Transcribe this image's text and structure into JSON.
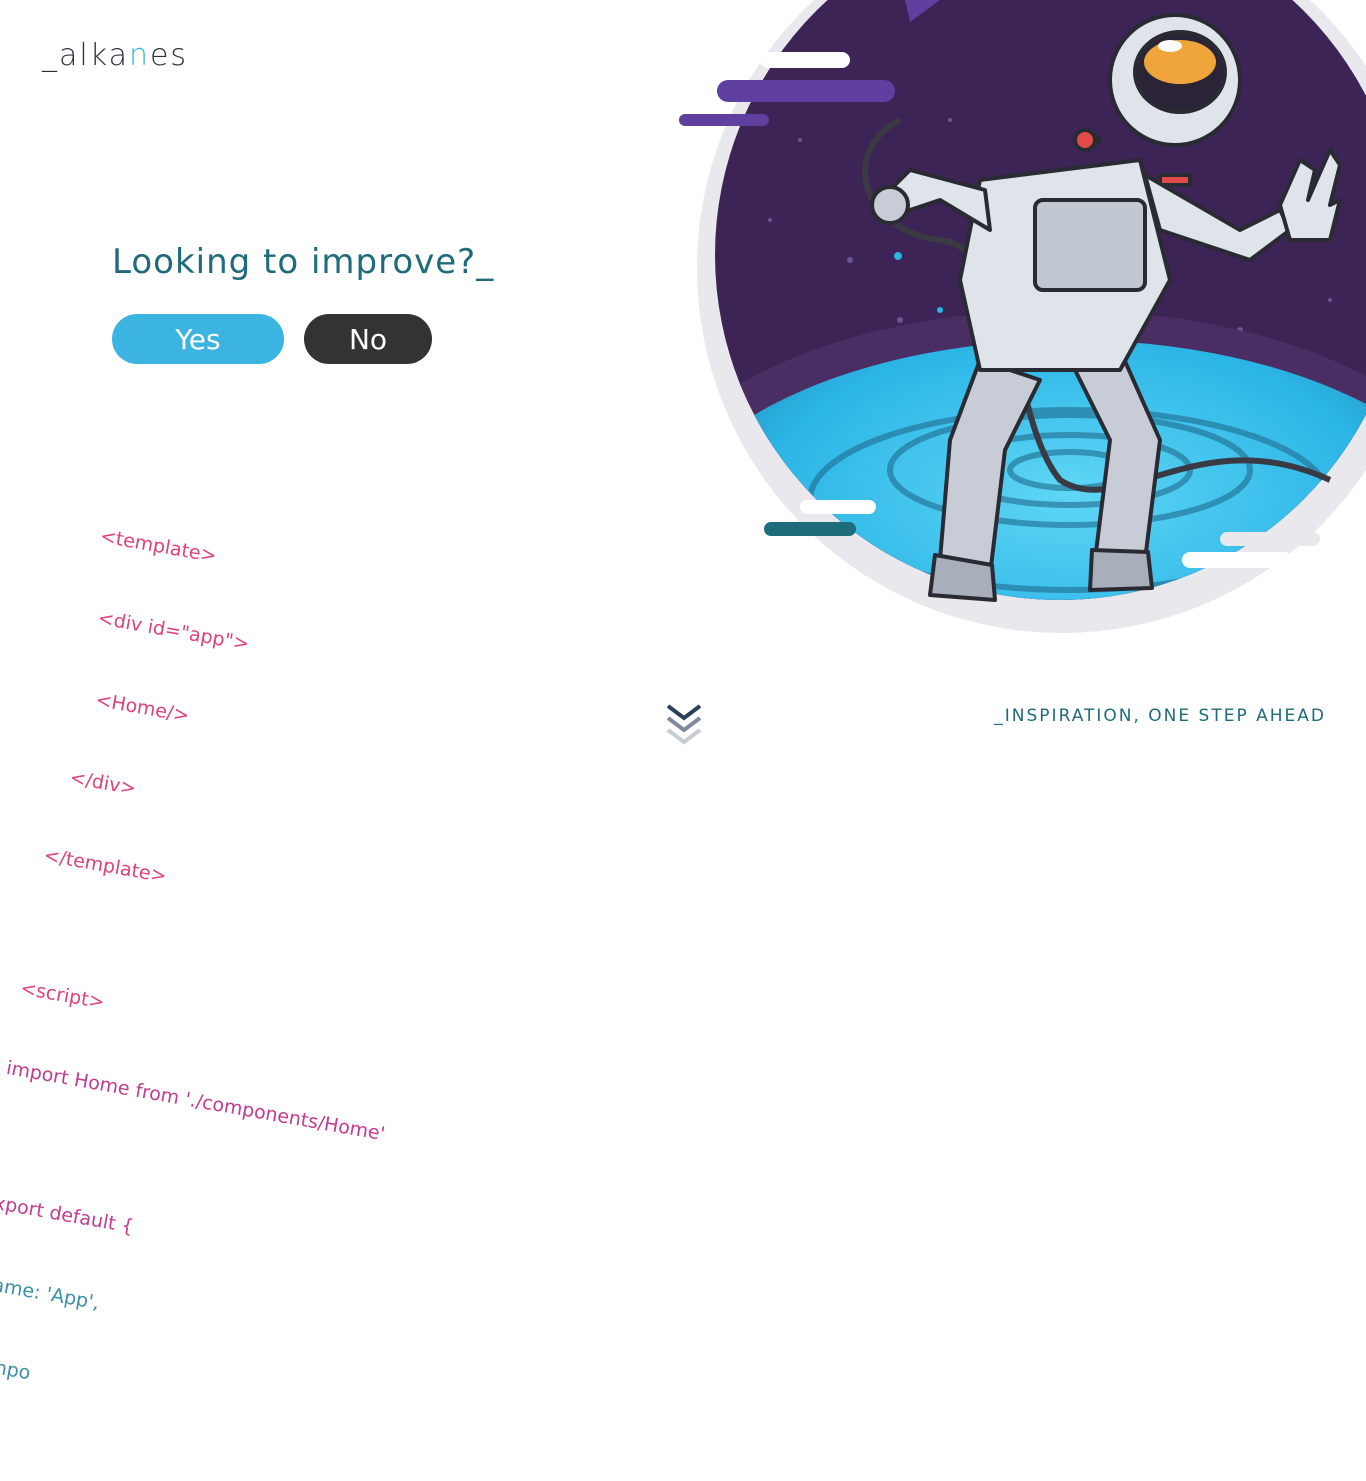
{
  "brand": {
    "prefix": "_alka",
    "accent_letter": "n",
    "suffix": "es"
  },
  "hero": {
    "headline": "Looking to improve?_"
  },
  "cta": {
    "yes_label": "Yes",
    "no_label": "No"
  },
  "code_snippet": {
    "lines": [
      "<template>",
      "  <div id=\"app\">",
      "    <Home/>",
      "  </div>",
      "</template>",
      "",
      "<script>",
      "import Home from './components/Home'",
      "",
      "export default {",
      "  name: 'App',",
      "  compo"
    ]
  },
  "footer": {
    "tagline": "_INSPIRATION, ONE STEP AHEAD"
  },
  "icons": {
    "scroll": "double-chevron-down-icon",
    "illustration": "astronaut-illustration"
  },
  "colors": {
    "accent": "#3cb4e1",
    "dark": "#333335",
    "teal": "#1e6b7b",
    "space": "#3c2456",
    "planet": "#2bb5e6"
  }
}
